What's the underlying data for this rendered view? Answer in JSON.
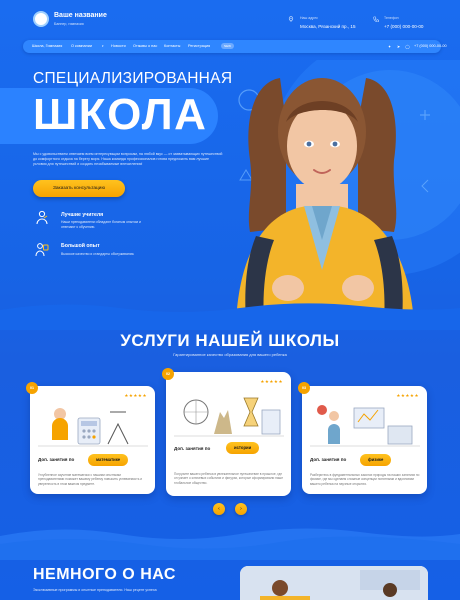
{
  "header": {
    "logo_title": "Ваше название",
    "logo_subtitle": "Баннер, гимназия",
    "address_label": "Наш адрес",
    "address": "Москва, Рязанский пр., 15",
    "phone_label": "Телефон",
    "phone": "+7 (000) 000-00-00"
  },
  "nav": {
    "items": [
      "Школа, Гимназия",
      "О компании",
      "Новости",
      "Отзывы о нас",
      "Контакты",
      "Регистрация"
    ],
    "badge": "NEW",
    "phone": "+7 (000) 000-00-00",
    "social_icons": [
      "vk-icon",
      "telegram-icon",
      "whatsapp-icon"
    ]
  },
  "hero": {
    "kicker": "СПЕЦИАЛИЗИРОВАННАЯ",
    "title": "ШКОЛА",
    "text": "Мы с удовольствием отвечаем всем интересующим вопросам, на любой вкус — от захватывающих путешествий до комфортного отдыха на берегу моря. Наша команда профессионалов готова предложить вам лучшие условия для путешествий и создать незабываемые впечатления!",
    "cta": "Заказать консультацию",
    "features": [
      {
        "title": "Лучшие учителя",
        "text": "Наши преподаватели обладают богатым опытом и отвечают к обучению."
      },
      {
        "title": "Большой опыт",
        "text": "Высокое качество и стандарты обслуживания."
      }
    ]
  },
  "services": {
    "title": "УСЛУГИ НАШЕЙ ШКОЛЫ",
    "subtitle": "Гарантированное качество образования для вашего ребенка",
    "stars": "★★★★★",
    "cards": [
      {
        "num": "01",
        "label": "Доп. занятия по",
        "pill": "математике",
        "text": "Углубленное изучение математики с нашими опытными преподавателями поможет вашему ребенку повысить успеваемость и уверенность в этом важном предмете."
      },
      {
        "num": "02",
        "label": "Доп. занятия по",
        "pill": "истории",
        "text": "Погрузите вашего ребенка в увлекательное путешествие в прошлое, где он узнает о ключевых событиях и фигурах, которые сформировали наше глобальное общество."
      },
      {
        "num": "03",
        "label": "Доп. занятия по",
        "pill": "физике",
        "text": "Разберитесь в фундаментальных законах природы на наших занятиях по физике, где мы сделаем сложные концепции понятными и вдохновим вашего ребенка на научные открытия."
      }
    ],
    "prev": "‹",
    "next": "›"
  },
  "about": {
    "title": "НЕМНОГО О НАС",
    "text": "Эксклюзивные программы и опытные преподаватели. Наш рецепт успеха"
  }
}
